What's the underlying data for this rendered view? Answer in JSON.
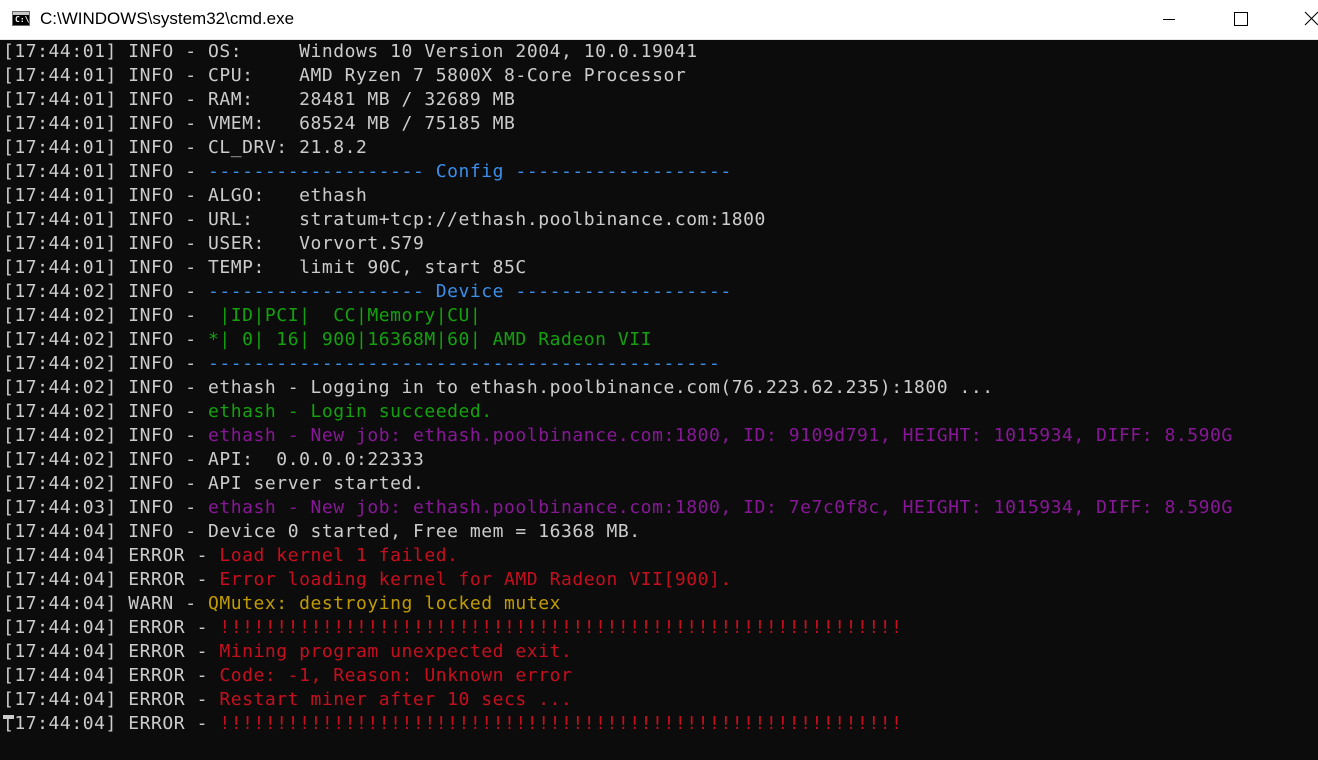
{
  "window": {
    "title": "C:\\WINDOWS\\system32\\cmd.exe",
    "app_icon_glyph": "C:\\",
    "controls": {
      "minimize_icon": "minimize-icon",
      "maximize_icon": "maximize-icon",
      "close_icon": "close-icon"
    }
  },
  "colors": {
    "background": "#0c0c0c",
    "default": "#cccccc",
    "blue": "#3b8eea",
    "green": "#13a10e",
    "purple": "#881798",
    "red": "#c50f1f",
    "yellow": "#c19c00"
  },
  "lines": [
    {
      "ts": "[17:44:01]",
      "lvl": " INFO - ",
      "msg": "OS:     Windows 10 Version 2004, 10.0.19041",
      "color": "default"
    },
    {
      "ts": "[17:44:01]",
      "lvl": " INFO - ",
      "msg": "CPU:    AMD Ryzen 7 5800X 8-Core Processor",
      "color": "default"
    },
    {
      "ts": "[17:44:01]",
      "lvl": " INFO - ",
      "msg": "RAM:    28481 MB / 32689 MB",
      "color": "default"
    },
    {
      "ts": "[17:44:01]",
      "lvl": " INFO - ",
      "msg": "VMEM:   68524 MB / 75185 MB",
      "color": "default"
    },
    {
      "ts": "[17:44:01]",
      "lvl": " INFO - ",
      "msg": "CL_DRV: 21.8.2",
      "color": "default"
    },
    {
      "ts": "[17:44:01]",
      "lvl": " INFO - ",
      "msg": "------------------- Config -------------------",
      "color": "blue"
    },
    {
      "ts": "[17:44:01]",
      "lvl": " INFO - ",
      "msg": "ALGO:   ethash",
      "color": "default"
    },
    {
      "ts": "[17:44:01]",
      "lvl": " INFO - ",
      "msg": "URL:    stratum+tcp://ethash.poolbinance.com:1800",
      "color": "default"
    },
    {
      "ts": "[17:44:01]",
      "lvl": " INFO - ",
      "msg": "USER:   Vorvort.S79",
      "color": "default"
    },
    {
      "ts": "[17:44:01]",
      "lvl": " INFO - ",
      "msg": "TEMP:   limit 90C, start 85C",
      "color": "default"
    },
    {
      "ts": "[17:44:02]",
      "lvl": " INFO - ",
      "msg": "------------------- Device -------------------",
      "color": "blue"
    },
    {
      "ts": "[17:44:02]",
      "lvl": " INFO - ",
      "msg": " |ID|PCI|  CC|Memory|CU|",
      "color": "green"
    },
    {
      "ts": "[17:44:02]",
      "lvl": " INFO - ",
      "msg": "*| 0| 16| 900|16368M|60| AMD Radeon VII",
      "color": "green"
    },
    {
      "ts": "[17:44:02]",
      "lvl": " INFO - ",
      "msg": "---------------------------------------------",
      "color": "blue"
    },
    {
      "ts": "[17:44:02]",
      "lvl": " INFO - ",
      "msg": "ethash - Logging in to ethash.poolbinance.com(76.223.62.235):1800 ...",
      "color": "default"
    },
    {
      "ts": "[17:44:02]",
      "lvl": " INFO - ",
      "msg": "ethash - Login succeeded.",
      "color": "green"
    },
    {
      "ts": "[17:44:02]",
      "lvl": " INFO - ",
      "msg": "ethash - New job: ethash.poolbinance.com:1800, ID: 9109d791, HEIGHT: 1015934, DIFF: 8.590G",
      "color": "purple"
    },
    {
      "ts": "[17:44:02]",
      "lvl": " INFO - ",
      "msg": "API:  0.0.0.0:22333",
      "color": "default"
    },
    {
      "ts": "[17:44:02]",
      "lvl": " INFO - ",
      "msg": "API server started.",
      "color": "default"
    },
    {
      "ts": "[17:44:03]",
      "lvl": " INFO - ",
      "msg": "ethash - New job: ethash.poolbinance.com:1800, ID: 7e7c0f8c, HEIGHT: 1015934, DIFF: 8.590G",
      "color": "purple"
    },
    {
      "ts": "[17:44:04]",
      "lvl": " INFO - ",
      "msg": "Device 0 started, Free mem = 16368 MB.",
      "color": "default"
    },
    {
      "ts": "[17:44:04]",
      "lvl": " ERROR - ",
      "msg": "Load kernel 1 failed.",
      "color": "red"
    },
    {
      "ts": "[17:44:04]",
      "lvl": " ERROR - ",
      "msg": "Error loading kernel for AMD Radeon VII[900].",
      "color": "red"
    },
    {
      "ts": "[17:44:04]",
      "lvl": " WARN - ",
      "msg": "QMutex: destroying locked mutex",
      "color": "yellow"
    },
    {
      "ts": "[17:44:04]",
      "lvl": " ERROR - ",
      "msg": "!!!!!!!!!!!!!!!!!!!!!!!!!!!!!!!!!!!!!!!!!!!!!!!!!!!!!!!!!!!!",
      "color": "red"
    },
    {
      "ts": "[17:44:04]",
      "lvl": " ERROR - ",
      "msg": "Mining program unexpected exit.",
      "color": "red"
    },
    {
      "ts": "[17:44:04]",
      "lvl": " ERROR - ",
      "msg": "Code: -1, Reason: Unknown error",
      "color": "red"
    },
    {
      "ts": "[17:44:04]",
      "lvl": " ERROR - ",
      "msg": "Restart miner after 10 secs ...",
      "color": "red"
    },
    {
      "ts": "[17:44:04]",
      "lvl": " ERROR - ",
      "msg": "!!!!!!!!!!!!!!!!!!!!!!!!!!!!!!!!!!!!!!!!!!!!!!!!!!!!!!!!!!!!",
      "color": "red"
    }
  ]
}
